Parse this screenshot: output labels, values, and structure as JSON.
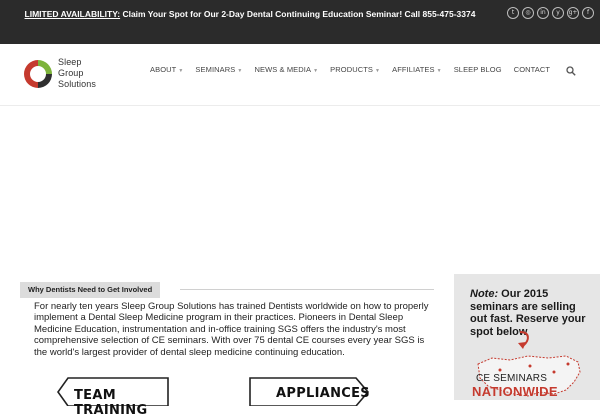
{
  "announcement": {
    "lead": "LIMITED AVAILABILITY:",
    "message": " Claim Your Spot for Our 2-Day Dental Continuing Education Seminar! Call 855-475-3374"
  },
  "social": {
    "icons": [
      "twitter-icon",
      "instagram-icon",
      "linkedin-icon",
      "yelp-icon",
      "google-plus-icon",
      "facebook-icon"
    ],
    "glyphs": [
      "t",
      "◎",
      "in",
      "y",
      "g+",
      "f"
    ]
  },
  "logo": {
    "line1": "Sleep",
    "line2": "Group",
    "line3": "Solutions",
    "colors": {
      "red": "#c53a2e",
      "dark": "#2f2f2f",
      "green": "#7db33b"
    }
  },
  "nav": {
    "items": [
      {
        "label": "ABOUT",
        "dropdown": true
      },
      {
        "label": "SEMINARS",
        "dropdown": true
      },
      {
        "label": "NEWS & MEDIA",
        "dropdown": true
      },
      {
        "label": "PRODUCTS",
        "dropdown": true
      },
      {
        "label": "AFFILIATES",
        "dropdown": true
      },
      {
        "label": "SLEEP BLOG",
        "dropdown": false
      },
      {
        "label": "CONTACT",
        "dropdown": false
      }
    ],
    "search_icon": "search-icon"
  },
  "content": {
    "section_label": "Why Dentists Need to Get Involved",
    "intro": "For nearly ten years Sleep Group Solutions has trained Dentists worldwide on how to properly implement a Dental Sleep Medicine program in their practices. Pioneers in Dental Sleep Medicine Education, instrumentation and in-office training SGS offers the industry's most comprehensive selection of CE seminars. With over 75 dental CE courses every year SGS is the world's largest provider of dental sleep medicine continuing education.",
    "signs": [
      "TEAM TRAINING",
      "APPLIANCES"
    ]
  },
  "sidebar": {
    "note_label": "Note:",
    "note_text": " Our 2015 seminars are selling out fast. Reserve your spot below",
    "ce_line1": "CE SEMINARS",
    "ce_line2": "NATIONWIDE",
    "colors": {
      "accent": "#c53a2e",
      "panel": "#e6e6e6"
    }
  },
  "colors": {
    "topbar": "#2b2b2b",
    "text": "#222222"
  }
}
